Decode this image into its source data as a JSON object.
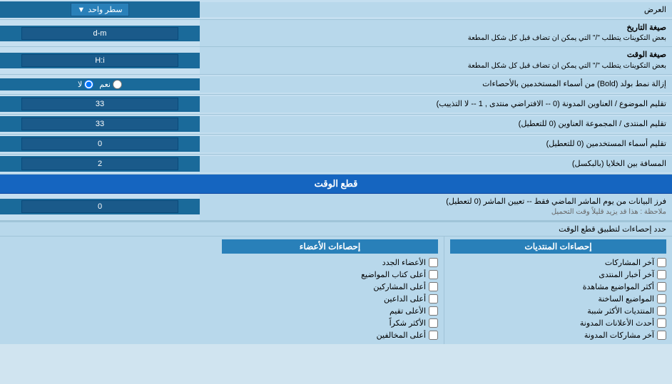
{
  "header": {
    "title": "العرض",
    "dropdown_label": "سطر واحد",
    "dropdown_icon": "▼"
  },
  "rows": [
    {
      "id": "date_format",
      "label": "صيغة التاريخ",
      "sublabel": "بعض التكوينات يتطلب \"/\" التي يمكن ان تضاف قبل كل شكل المطعة",
      "value": "d-m",
      "type": "input"
    },
    {
      "id": "time_format",
      "label": "صيغة الوقت",
      "sublabel": "بعض التكوينات يتطلب \"/\" التي يمكن ان تضاف قبل كل شكل المطعة",
      "value": "H:i",
      "type": "input"
    },
    {
      "id": "bold_remove",
      "label": "إزالة نمط بولد (Bold) من أسماء المستخدمين بالأحصاءات",
      "value_yes": "نعم",
      "value_no": "لا",
      "selected": "no",
      "type": "radio"
    },
    {
      "id": "topic_subject",
      "label": "تقليم الموضوع / العناوين المدونة (0 -- الافتراضي منتدى , 1 -- لا التذييب)",
      "value": "33",
      "type": "input"
    },
    {
      "id": "forum_address",
      "label": "تقليم المنتدى / المجموعة العناوين (0 للتعطيل)",
      "value": "33",
      "type": "input"
    },
    {
      "id": "usernames",
      "label": "تقليم أسماء المستخدمين (0 للتعطيل)",
      "value": "0",
      "type": "input"
    },
    {
      "id": "cell_distance",
      "label": "المسافة بين الخلايا (بالبكسل)",
      "value": "2",
      "type": "input"
    }
  ],
  "section_realtime": {
    "title": "قطع الوقت",
    "row_label": "فرز البيانات من يوم الماشر الماضي فقط -- تعيين الماشر (0 لتعطيل)",
    "row_note": "ملاحظة : هذا قد يزيد قليلاً وقت التحميل",
    "row_value": "0"
  },
  "checkboxes_section": {
    "limit_label": "حدد إحصاءات لتطبيق قطع الوقت",
    "col1_header": "إحصاءات المنتديات",
    "col2_header": "إحصاءات الأعضاء",
    "col1_items": [
      "آخر المشاركات",
      "آخر أخبار المنتدى",
      "أكثر المواضيع مشاهدة",
      "المواضيع الساخنة",
      "المنتديات الأكثر شببة",
      "أحدث الأعلانات المدونة",
      "آخر مشاركات المدونة"
    ],
    "col2_items": [
      "الأعضاء الجدد",
      "أعلى كتاب المواضيع",
      "أعلى المشاركين",
      "أعلى الداعين",
      "الأعلى تقيم",
      "الأكثر شكراً",
      "أعلى المخالفين"
    ]
  }
}
